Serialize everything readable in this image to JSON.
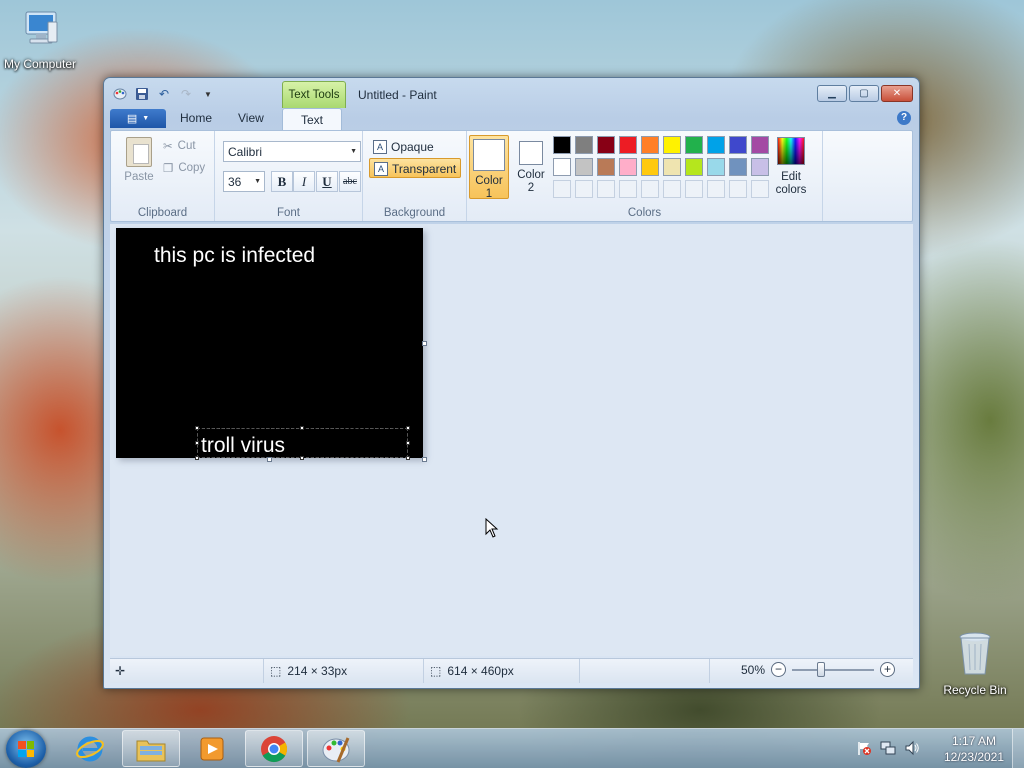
{
  "desktop": {
    "computer_label": "My Computer",
    "recycle_label": "Recycle Bin"
  },
  "window": {
    "title": "Untitled - Paint",
    "context_tab": "Text Tools"
  },
  "tabs": {
    "home": "Home",
    "view": "View",
    "text": "Text"
  },
  "clipboard": {
    "paste": "Paste",
    "cut": "Cut",
    "copy": "Copy",
    "label": "Clipboard"
  },
  "font": {
    "family": "Calibri",
    "size": "36",
    "bold": "B",
    "italic": "I",
    "underline": "U",
    "strike": "abc",
    "label": "Font"
  },
  "background": {
    "opaque": "Opaque",
    "transparent": "Transparent",
    "label": "Background"
  },
  "colors": {
    "color1_line1": "Color",
    "color1_line2": "1",
    "color2_line1": "Color",
    "color2_line2": "2",
    "edit_line1": "Edit",
    "edit_line2": "colors",
    "label": "Colors",
    "palette_row1": [
      "#000000",
      "#7f7f7f",
      "#880015",
      "#ed1c24",
      "#ff7f27",
      "#fff200",
      "#22b14c",
      "#00a2e8",
      "#3f48cc",
      "#a349a4"
    ],
    "palette_row2": [
      "#ffffff",
      "#c3c3c3",
      "#b97a57",
      "#ffaec9",
      "#ffc90e",
      "#efe4b0",
      "#b5e61d",
      "#99d9ea",
      "#7092be",
      "#c8bfe7"
    ]
  },
  "canvas": {
    "text1": "this pc is infected",
    "text2": "troll virus"
  },
  "status": {
    "selection_size": "214 × 33px",
    "image_size": "614 × 460px",
    "zoom": "50%",
    "zoom_fraction": 0.35
  },
  "taskbar": {
    "time": "1:17 AM",
    "date": "12/23/2021"
  }
}
